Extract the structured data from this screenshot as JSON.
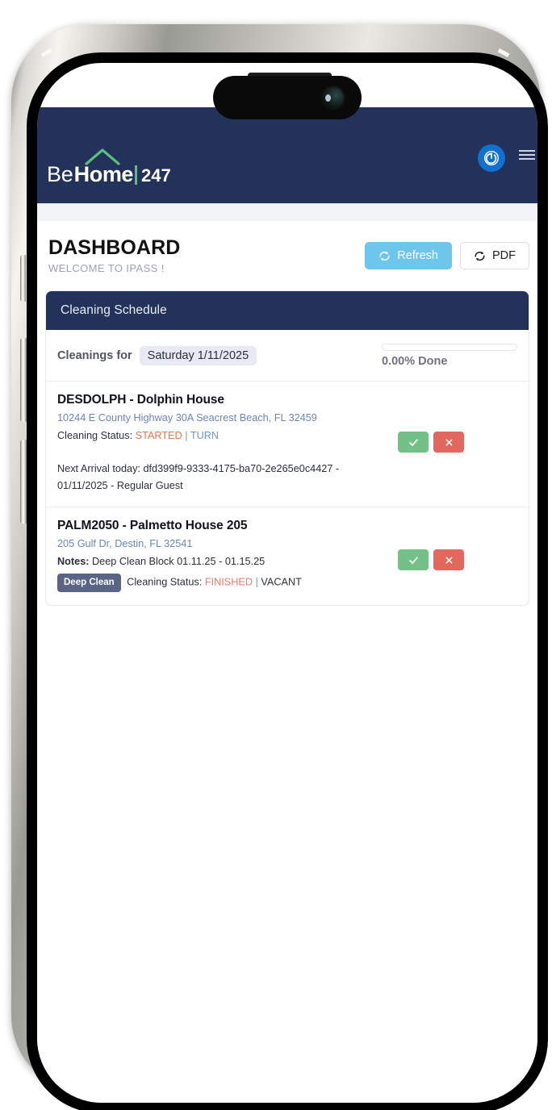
{
  "brand": {
    "logo_be": "Be",
    "logo_home": "Home",
    "logo_247": "247",
    "accent_green": "#5bbf7b",
    "navy": "#22325a"
  },
  "navbar": {
    "power_icon": "power-icon",
    "menu_icon": "hamburger-menu-icon"
  },
  "page": {
    "title": "DASHBOARD",
    "subtitle": "WELCOME TO IPASS !"
  },
  "toolbar": {
    "refresh_label": "Refresh",
    "refresh_icon": "refresh-icon",
    "refresh_color": "#6ec6ec",
    "pdf_label": "PDF",
    "pdf_icon": "refresh-icon"
  },
  "card": {
    "header": "Cleaning Schedule"
  },
  "schedule": {
    "cleanings_for_label": "Cleanings for",
    "date": "Saturday 1/11/2025",
    "progress_percent": 0,
    "progress_text": "0.00% Done"
  },
  "listings": [
    {
      "title": "DESDOLPH - Dolphin House",
      "address": "10244 E County Highway 30A Seacrest Beach, FL 32459",
      "status_label": "Cleaning Status:",
      "status_value": "STARTED",
      "status_separator": "|",
      "occupancy": "TURN",
      "next_arrival": "Next Arrival today: dfd399f9-9333-4175-ba70-2e265e0c4427 - 01/11/2025 - Regular Guest",
      "approve_icon": "check-icon",
      "reject_icon": "close-icon"
    },
    {
      "title": "PALM2050 - Palmetto House 205",
      "address": "205 Gulf Dr, Destin, FL 32541",
      "notes_label": "Notes:",
      "notes_value": "Deep Clean Block 01.11.25 - 01.15.25",
      "tag": "Deep Clean",
      "status_label": "Cleaning Status:",
      "status_value": "FINISHED",
      "status_separator": "|",
      "occupancy": "VACANT",
      "approve_icon": "check-icon",
      "reject_icon": "close-icon"
    }
  ]
}
